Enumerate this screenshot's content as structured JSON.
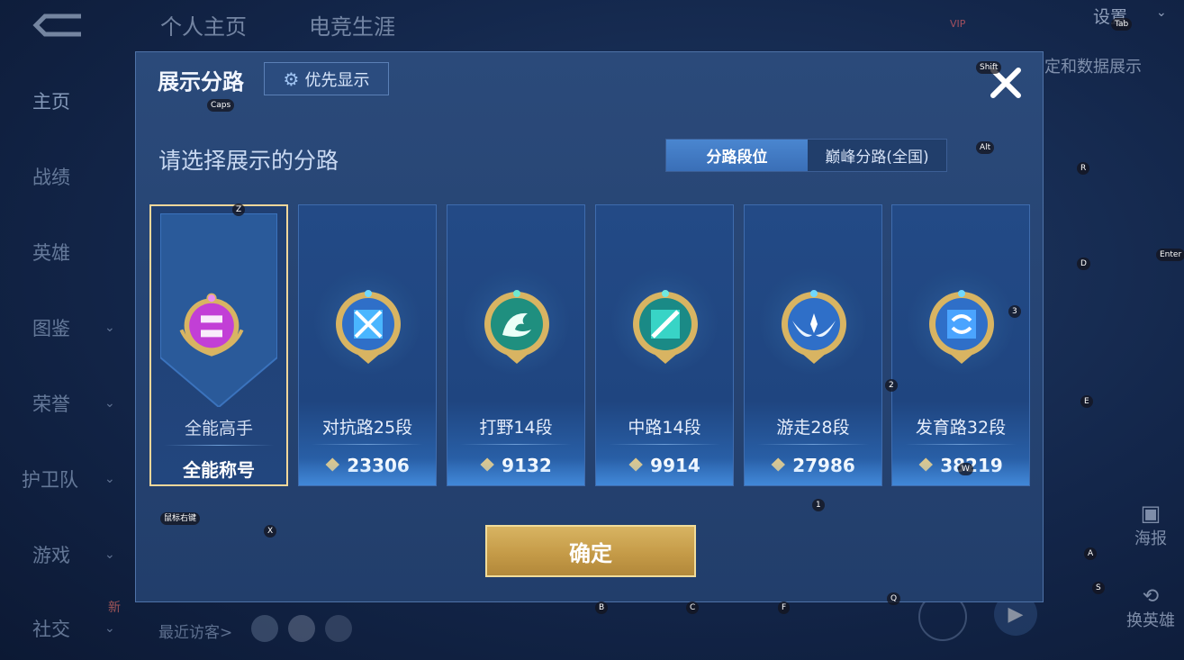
{
  "top_tabs": [
    "个人主页",
    "电竞生涯"
  ],
  "top_right": {
    "settings": "设置",
    "vip": "VIP",
    "data_display": "定和数据展示"
  },
  "sidebar": {
    "items": [
      {
        "label": "主页",
        "chevron": false
      },
      {
        "label": "战绩",
        "chevron": false
      },
      {
        "label": "英雄",
        "chevron": false
      },
      {
        "label": "图鉴",
        "chevron": true
      },
      {
        "label": "荣誉",
        "chevron": true
      },
      {
        "label": "护卫队",
        "chevron": true
      },
      {
        "label": "游戏",
        "chevron": true
      },
      {
        "label": "社交",
        "chevron": true
      }
    ],
    "new_badge": "新"
  },
  "recent_visitors": "最近访客>",
  "right_panel": {
    "poster": "海报",
    "change_hero": "换英雄"
  },
  "modal": {
    "title": "展示分路",
    "priority_button": "优先显示",
    "prompt": "请选择展示的分路",
    "toggle": [
      "分路段位",
      "巅峰分路(全国)"
    ],
    "confirm": "确定",
    "cards": [
      {
        "name": "全能高手",
        "value": "全能称号",
        "selected": true,
        "emblem": "all-round-emblem",
        "color": "#c23fd6"
      },
      {
        "name": "对抗路25段",
        "value": "23306",
        "selected": false,
        "emblem": "clash-lane-emblem",
        "color": "#4ab6ff"
      },
      {
        "name": "打野14段",
        "value": "9132",
        "selected": false,
        "emblem": "jungle-emblem",
        "color": "#2fc9a8"
      },
      {
        "name": "中路14段",
        "value": "9914",
        "selected": false,
        "emblem": "mid-lane-emblem",
        "color": "#38d4c6"
      },
      {
        "name": "游走28段",
        "value": "27986",
        "selected": false,
        "emblem": "roam-emblem",
        "color": "#5aaaf5"
      },
      {
        "name": "发育路32段",
        "value": "38219",
        "selected": false,
        "emblem": "farm-lane-emblem",
        "color": "#4aa4ff"
      }
    ]
  },
  "key_hints": [
    "Caps",
    "Shift",
    "Tab",
    "Alt",
    "R",
    "Enter",
    "D",
    "3",
    "2",
    "E",
    "Z",
    "W",
    "X",
    "1",
    "A",
    "B",
    "C",
    "F",
    "Q",
    "S",
    "鼠标右键"
  ],
  "colors": {
    "accent": "#4f8fe0",
    "gold": "#d8b462",
    "selected_border": "#f3d79a"
  }
}
